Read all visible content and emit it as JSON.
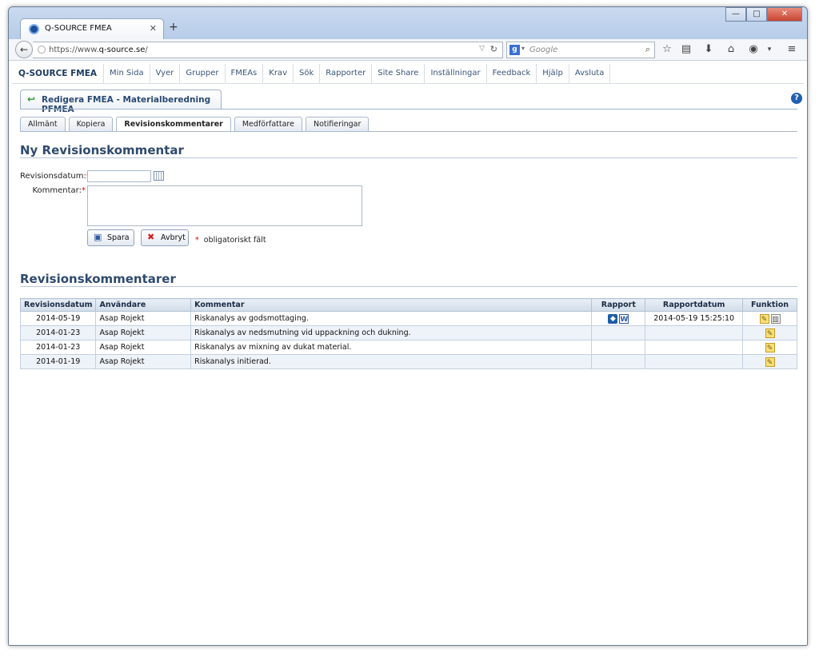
{
  "browser": {
    "tab_title": "Q-SOURCE FMEA",
    "tab_close": "✕",
    "new_tab": "+",
    "url_prefix": "https://www.",
    "url_domain": "q-source.se",
    "url_suffix": "/",
    "search_engine": "g",
    "search_placeholder": "Google",
    "win_minimize": "—",
    "win_maximize": "□",
    "win_close": "✕"
  },
  "menu": {
    "brand": "Q-SOURCE FMEA",
    "items": [
      "Min Sida",
      "Vyer",
      "Grupper",
      "FMEAs",
      "Krav",
      "Sök",
      "Rapporter",
      "Site Share",
      "Inställningar",
      "Feedback",
      "Hjälp",
      "Avsluta"
    ]
  },
  "page": {
    "tab_title": "Redigera FMEA - Materialberedning PFMEA",
    "help": "?"
  },
  "subtabs": [
    "Allmänt",
    "Kopiera",
    "Revisionskommentarer",
    "Medförfattare",
    "Notifieringar"
  ],
  "form": {
    "heading": "Ny Revisionskommentar",
    "date_label": "Revisionsdatum:",
    "comment_label": "Kommentar:",
    "required_mark": "*",
    "save_label": "Spara",
    "cancel_label": "Avbryt",
    "required_note": "obligatoriskt fält"
  },
  "list": {
    "heading": "Revisionskommentarer",
    "columns": [
      "Revisionsdatum",
      "Användare",
      "Kommentar",
      "Rapport",
      "Rapportdatum",
      "Funktion"
    ],
    "rows": [
      {
        "date": "2014-05-19",
        "user": "Asap Rojekt",
        "comment": "Riskanalys av godsmottaging.",
        "report_date": "2014-05-19 15:25:10"
      },
      {
        "date": "2014-01-23",
        "user": "Asap Rojekt",
        "comment": "Riskanalys av nedsmutning vid uppackning och dukning.",
        "report_date": ""
      },
      {
        "date": "2014-01-23",
        "user": "Asap Rojekt",
        "comment": "Riskanalys av mixning av dukat material.",
        "report_date": ""
      },
      {
        "date": "2014-01-19",
        "user": "Asap Rojekt",
        "comment": "Riskanalys initierad.",
        "report_date": ""
      }
    ]
  },
  "colors": {
    "heading": "#2f4a6e",
    "required": "#dd0000",
    "row_alt": "#eef3f9"
  }
}
